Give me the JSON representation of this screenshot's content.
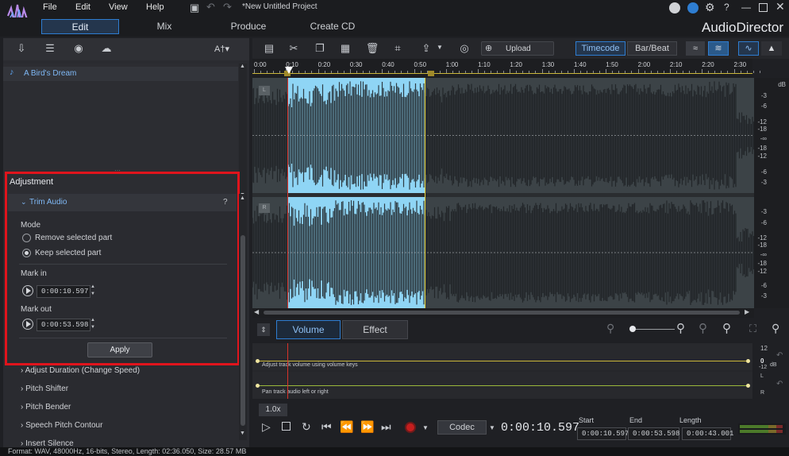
{
  "app": {
    "logo_name": "audiodirector-logo-icon",
    "brand": "AudioDirector",
    "project_title": "*New Untitled Project"
  },
  "menu": [
    "File",
    "Edit",
    "View",
    "Help"
  ],
  "modes": [
    {
      "label": "Edit",
      "active": true
    },
    {
      "label": "Mix"
    },
    {
      "label": "Produce"
    },
    {
      "label": "Create CD"
    }
  ],
  "library": {
    "font_size_label": "A†▾",
    "items": [
      "A Bird's Dream"
    ]
  },
  "adjustment": {
    "section_title": "Adjustment",
    "trim_title": "Trim Audio",
    "help": "?",
    "mode_label": "Mode",
    "options": [
      "Remove selected part",
      "Keep selected part"
    ],
    "selected_option": 1,
    "mark_in_label": "Mark in",
    "mark_in_value": "0:00:10.597",
    "mark_out_label": "Mark out",
    "mark_out_value": "0:00:53.598",
    "apply_label": "Apply",
    "features": [
      "Adjust Duration (Change Speed)",
      "Pitch Shifter",
      "Pitch Bender",
      "Speech Pitch Contour",
      "Insert Silence"
    ]
  },
  "toolbar": {
    "upload_label": "Upload",
    "timecode_label": "Timecode",
    "barbeat_label": "Bar/Beat"
  },
  "ruler_ticks": [
    "0:00",
    "0:10",
    "0:20",
    "0:30",
    "0:40",
    "0:50",
    "1:00",
    "1:10",
    "1:20",
    "1:30",
    "1:40",
    "1:50",
    "2:00",
    "2:10",
    "2:20",
    "2:30"
  ],
  "channels": {
    "left": "L",
    "right": "R"
  },
  "db_scale": {
    "unit": "dB",
    "labels": [
      "-3",
      "-6",
      "-12",
      "-18",
      "-∞",
      "-18",
      "-12",
      "-6",
      "-3"
    ]
  },
  "bottom_tabs": {
    "volume": "Volume",
    "effect": "Effect"
  },
  "envelope": {
    "volume_hint": "Adjust track volume using volume keys",
    "pan_hint": "Pan track audio left or right",
    "vol_scale": [
      "12",
      "0",
      "-12"
    ],
    "vol_unit": "dB",
    "pan_scale": [
      "L",
      "R"
    ]
  },
  "transport": {
    "speed": "1.0x",
    "codec_label": "Codec",
    "current_time": "0:00:10.597",
    "start_label": "Start",
    "start_value": "0:00:10.597",
    "end_label": "End",
    "end_value": "0:00:53.598",
    "length_label": "Length",
    "length_value": "0:00:43.001"
  },
  "status": "Format: WAV, 48000Hz, 16-bits, Stereo, Length: 02:36.050, Size: 28.57 MB",
  "colors": {
    "accent": "#2e7dd1",
    "selection": "#8fd5f5",
    "wave": "#1e2124",
    "highlight_box": "#e0141c",
    "mark_in": "#d8332a",
    "mark_out": "#e6d23a"
  }
}
